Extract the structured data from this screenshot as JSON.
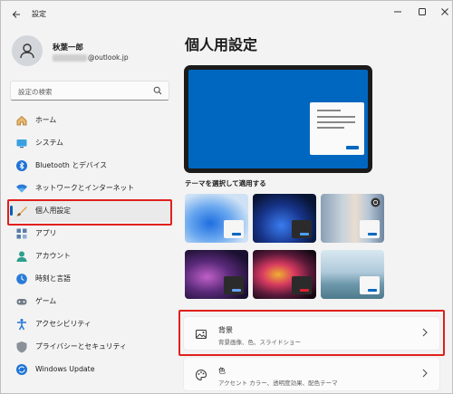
{
  "window": {
    "title": "設定"
  },
  "user": {
    "name": "秋葉一郎",
    "email_suffix": "@outlook.jp"
  },
  "search": {
    "placeholder": "設定の検索"
  },
  "sidebar": {
    "items": [
      {
        "label": "ホーム",
        "icon": "home-icon"
      },
      {
        "label": "システム",
        "icon": "system-icon"
      },
      {
        "label": "Bluetooth とデバイス",
        "icon": "bluetooth-icon"
      },
      {
        "label": "ネットワークとインターネット",
        "icon": "wifi-icon"
      },
      {
        "label": "個人用設定",
        "icon": "brush-icon",
        "selected": true
      },
      {
        "label": "アプリ",
        "icon": "apps-icon"
      },
      {
        "label": "アカウント",
        "icon": "account-icon"
      },
      {
        "label": "時刻と言語",
        "icon": "clock-globe-icon"
      },
      {
        "label": "ゲーム",
        "icon": "gamepad-icon"
      },
      {
        "label": "アクセシビリティ",
        "icon": "accessibility-icon"
      },
      {
        "label": "プライバシーとセキュリティ",
        "icon": "shield-icon"
      },
      {
        "label": "Windows Update",
        "icon": "update-icon"
      }
    ]
  },
  "main": {
    "title": "個人用設定",
    "themes_label": "テーマを選択して適用する",
    "cards": [
      {
        "title": "背景",
        "subtitle": "背景画像、色、スライドショー",
        "icon": "image-icon"
      },
      {
        "title": "色",
        "subtitle": "アクセント カラー、透明度効果、配色テーマ",
        "icon": "palette-icon"
      }
    ]
  },
  "colors": {
    "accent": "#005fb8",
    "highlight": "#e0201c"
  }
}
